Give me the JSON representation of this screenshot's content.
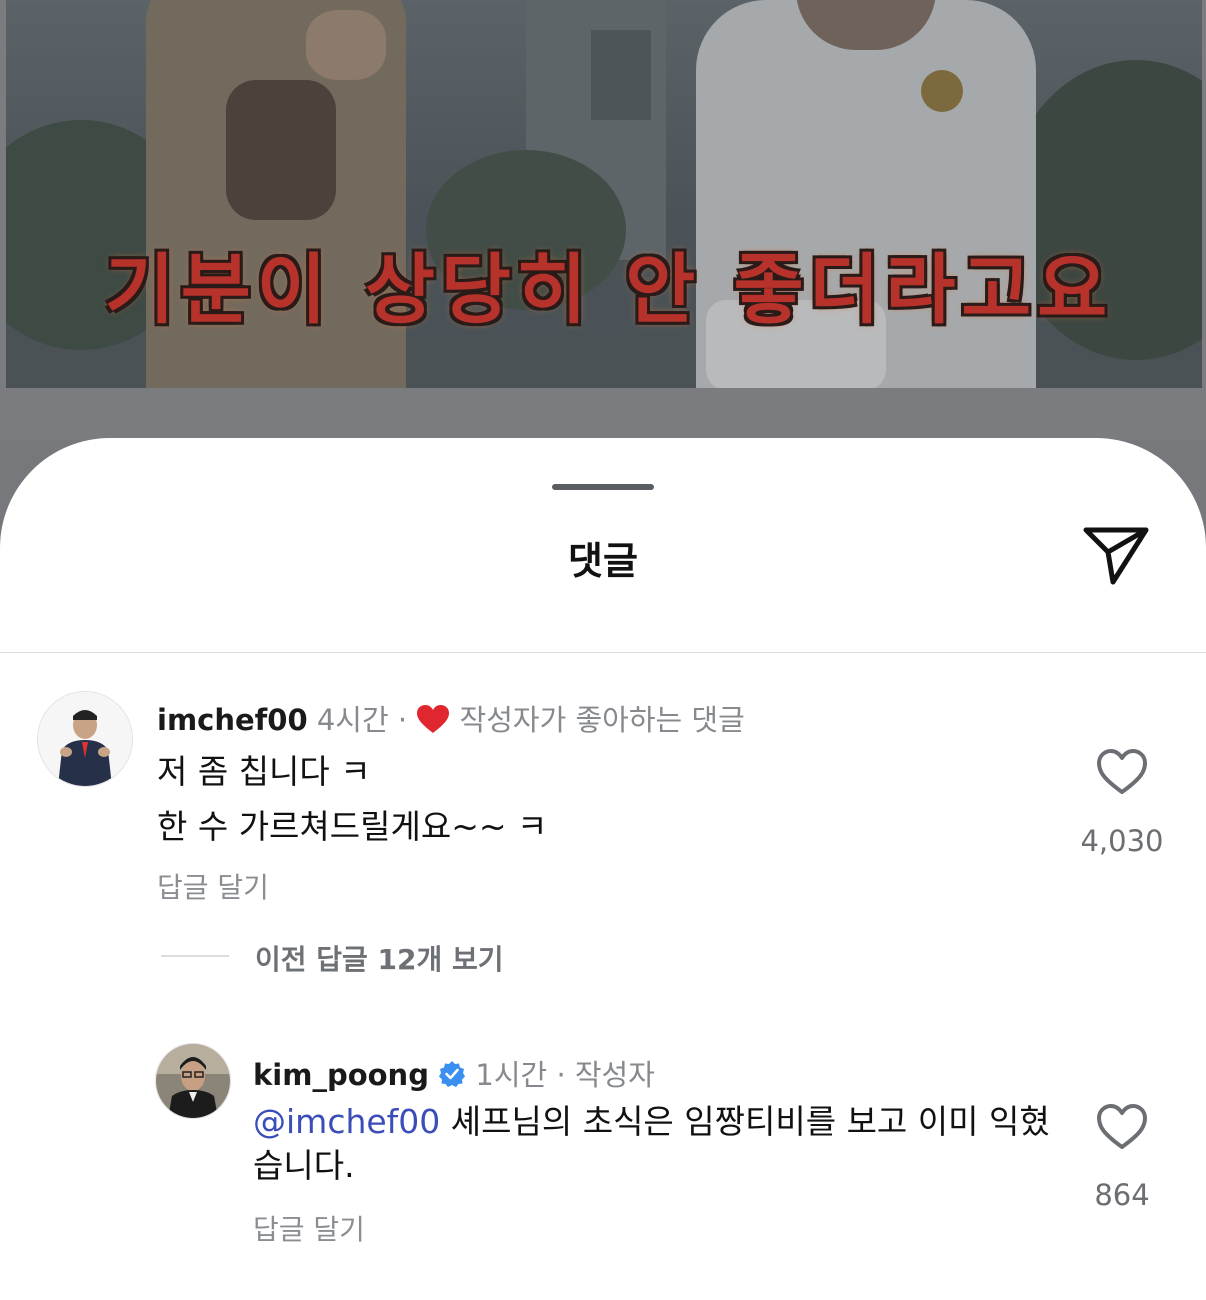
{
  "video": {
    "caption": "기분이 상당히 안 좋더라고요"
  },
  "sheet": {
    "title": "댓글"
  },
  "comments": [
    {
      "username": "imchef00",
      "time": "4시간",
      "separator": "·",
      "badge": "작성자가 좋아하는 댓글",
      "lines": [
        "저 좀 칩니다 ㅋ",
        "한 수 가르쳐드릴게요~~ ㅋ"
      ],
      "reply_label": "답글 달기",
      "likes": "4,030"
    }
  ],
  "view_replies": "이전 답글 12개 보기",
  "replies": [
    {
      "username": "kim_poong",
      "verified": true,
      "time": "1시간",
      "separator": "·",
      "role": "작성자",
      "mention": "@imchef00",
      "text": " 셰프님의 초식은 임짱티비를 보고 이미 익혔습니다.",
      "reply_label": "답글 달기",
      "likes": "864"
    }
  ],
  "colors": {
    "accent_mention": "#3a4db8",
    "heart_red": "#e0262f",
    "verified_blue": "#3a8ff0"
  },
  "icons": [
    "send-icon",
    "heart-icon",
    "verified-icon"
  ]
}
